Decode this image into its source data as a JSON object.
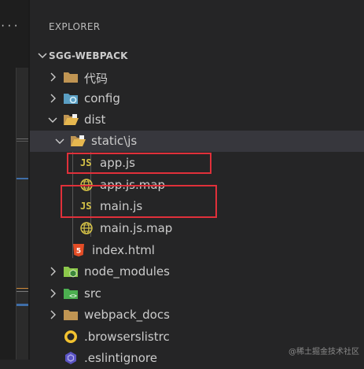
{
  "editor": {
    "more_dots": "···"
  },
  "explorer": {
    "title": "EXPLORER",
    "project": "SGG-WEBPACK"
  },
  "tree": {
    "daima": "代码",
    "config": "config",
    "dist": "dist",
    "static_js": {
      "part1": "static",
      "sep": "\\",
      "part2": "js"
    },
    "app_js": "app.js",
    "app_js_map": "app.js.map",
    "main_js": "main.js",
    "main_js_map": "main.js.map",
    "index_html": "index.html",
    "node_modules": "node_modules",
    "src": "src",
    "webpack_docs": "webpack_docs",
    "browserslistrc": ".browserslistrc",
    "eslintignore": ".eslintignore"
  },
  "badges": {
    "js": "JS"
  },
  "watermark": "@稀土掘金技术社区",
  "colors": {
    "highlight_box": "#e0303a",
    "js_yellow": "#d7c447",
    "folder": "#c09553",
    "html_orange": "#e44d26",
    "node_green": "#8cc84b"
  }
}
